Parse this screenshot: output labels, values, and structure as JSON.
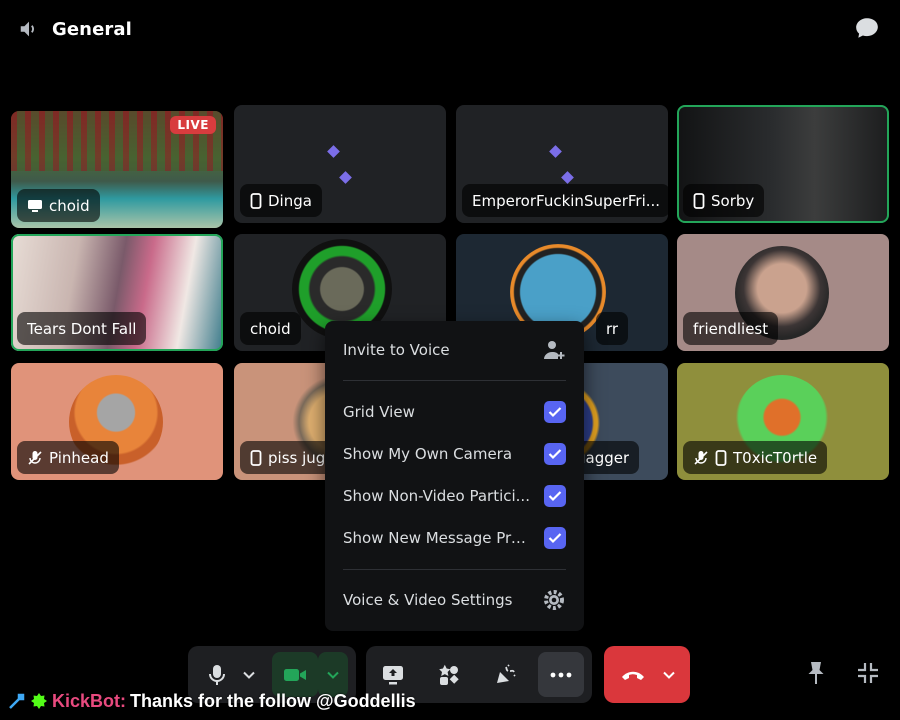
{
  "header": {
    "channel_title": "General"
  },
  "tiles": [
    {
      "name": "choid",
      "device": "screen",
      "live_label": "LIVE"
    },
    {
      "name": "Dinga",
      "device": "phone"
    },
    {
      "name": "EmperorFuckinSuperFri...",
      "device": "none"
    },
    {
      "name": "Sorby",
      "device": "phone",
      "speaking": true
    },
    {
      "name": "Tears Dont Fall",
      "device": "none",
      "speaking": true
    },
    {
      "name": "choid",
      "device": "none"
    },
    {
      "name": "rr",
      "device": "none"
    },
    {
      "name": "friendliest",
      "device": "none"
    },
    {
      "name": "Pinhead",
      "device": "muted"
    },
    {
      "name": "piss jug",
      "device": "phone"
    },
    {
      "name": "uagger",
      "device": "none"
    },
    {
      "name": "T0xicT0rtle",
      "device": "muted-phone"
    }
  ],
  "menu": {
    "invite_label": "Invite to Voice",
    "options": [
      {
        "label": "Grid View",
        "checked": true
      },
      {
        "label": "Show My Own Camera",
        "checked": true
      },
      {
        "label": "Show Non-Video Partici...",
        "checked": true
      },
      {
        "label": "Show New Message Prev...",
        "checked": true
      }
    ],
    "settings_label": "Voice & Video Settings"
  },
  "controls": {
    "icons": [
      "microphone-icon",
      "camera-icon",
      "screen-share-icon",
      "activities-icon",
      "soundboard-icon",
      "more-icon",
      "disconnect-icon",
      "pin-icon",
      "minimize-icon"
    ]
  },
  "chat_overlay": {
    "bot_name": "KickBot:",
    "message": "Thanks for the follow @Goddellis"
  },
  "colors": {
    "accent": "#5865f2",
    "speaking": "#23a559",
    "danger": "#da373c",
    "live": "#d83c3e"
  }
}
